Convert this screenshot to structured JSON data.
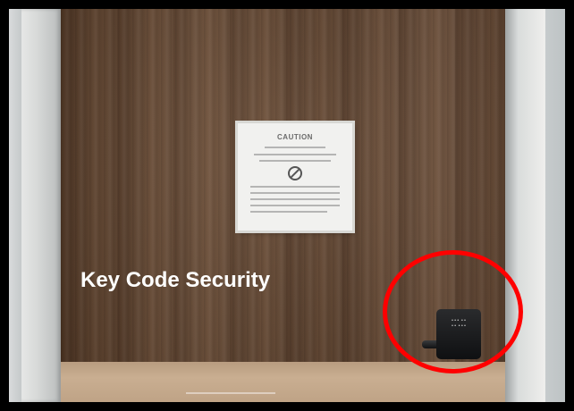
{
  "caption": "Key Code Security",
  "sign": {
    "title": "CAUTION"
  },
  "colors": {
    "highlight": "#ff0000",
    "border": "#000000",
    "caption": "#ffffff"
  }
}
